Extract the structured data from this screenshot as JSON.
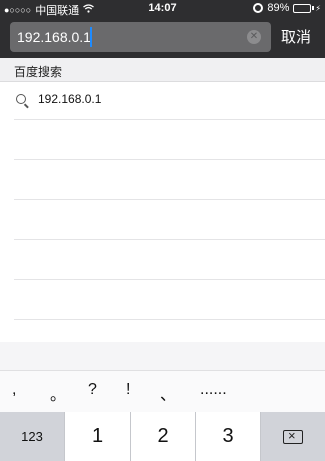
{
  "status_bar": {
    "signal": "●○○○○",
    "carrier": "中国联通",
    "wifi": "wifi-icon",
    "time": "14:07",
    "battery_percent": "89%",
    "battery_level": 0.89
  },
  "search": {
    "value": "192.168.0.1",
    "clear_icon": "clear-icon",
    "cancel_label": "取消"
  },
  "section": {
    "title": "百度搜索"
  },
  "suggestions": [
    {
      "icon": "search-icon",
      "text": "192.168.0.1"
    }
  ],
  "keyboard": {
    "candidates": [
      ",",
      "。",
      "?",
      "!",
      "、",
      "......"
    ],
    "keys": [
      "123",
      "1",
      "2",
      "3"
    ],
    "backspace_icon": "backspace-icon"
  },
  "colors": {
    "top_bar": "#2e2e30",
    "search_field": "#6a6a6c",
    "caret": "#1e8bff",
    "battery_fill": "#4cd964"
  }
}
